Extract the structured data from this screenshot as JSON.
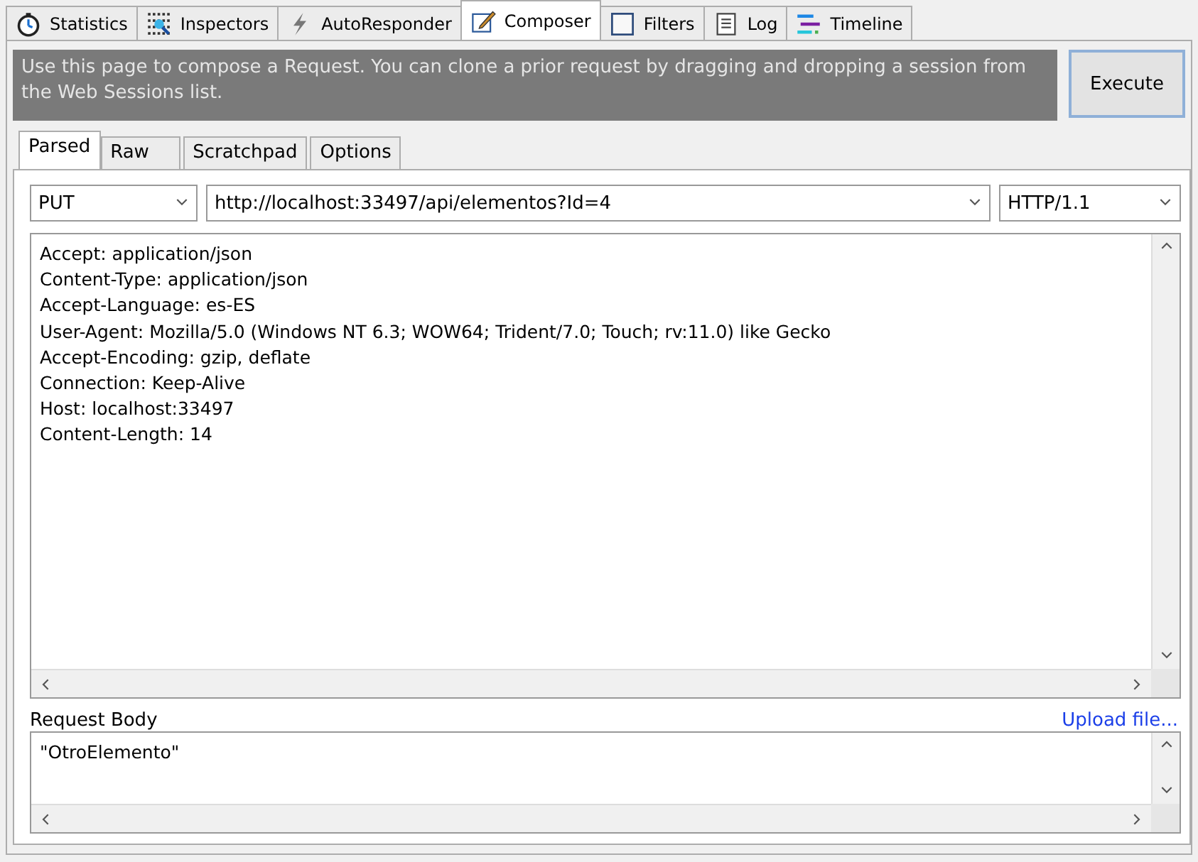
{
  "tabs": [
    {
      "label": "Statistics",
      "selected": false
    },
    {
      "label": "Inspectors",
      "selected": false
    },
    {
      "label": "AutoResponder",
      "selected": false
    },
    {
      "label": "Composer",
      "selected": true
    },
    {
      "label": "Filters",
      "selected": false
    },
    {
      "label": "Log",
      "selected": false
    },
    {
      "label": "Timeline",
      "selected": false
    }
  ],
  "info": "Use this page to compose a Request. You can clone a prior request by dragging and dropping a session from the Web Sessions list.",
  "execute_button": "Execute",
  "subtabs": [
    {
      "label": "Parsed",
      "selected": true
    },
    {
      "label": "Raw",
      "selected": false
    },
    {
      "label": "Scratchpad",
      "selected": false
    },
    {
      "label": "Options",
      "selected": false
    }
  ],
  "method": "PUT",
  "url": "http://localhost:33497/api/elementos?Id=4",
  "version": "HTTP/1.1",
  "headers": [
    "Accept: application/json",
    "Content-Type: application/json",
    "Accept-Language: es-ES",
    "User-Agent: Mozilla/5.0 (Windows NT 6.3; WOW64; Trident/7.0; Touch; rv:11.0) like Gecko",
    "Accept-Encoding: gzip, deflate",
    "Connection: Keep-Alive",
    "Host: localhost:33497",
    "Content-Length: 14"
  ],
  "body_label": "Request Body",
  "upload_link": "Upload file...",
  "body": "\"OtroElemento\""
}
